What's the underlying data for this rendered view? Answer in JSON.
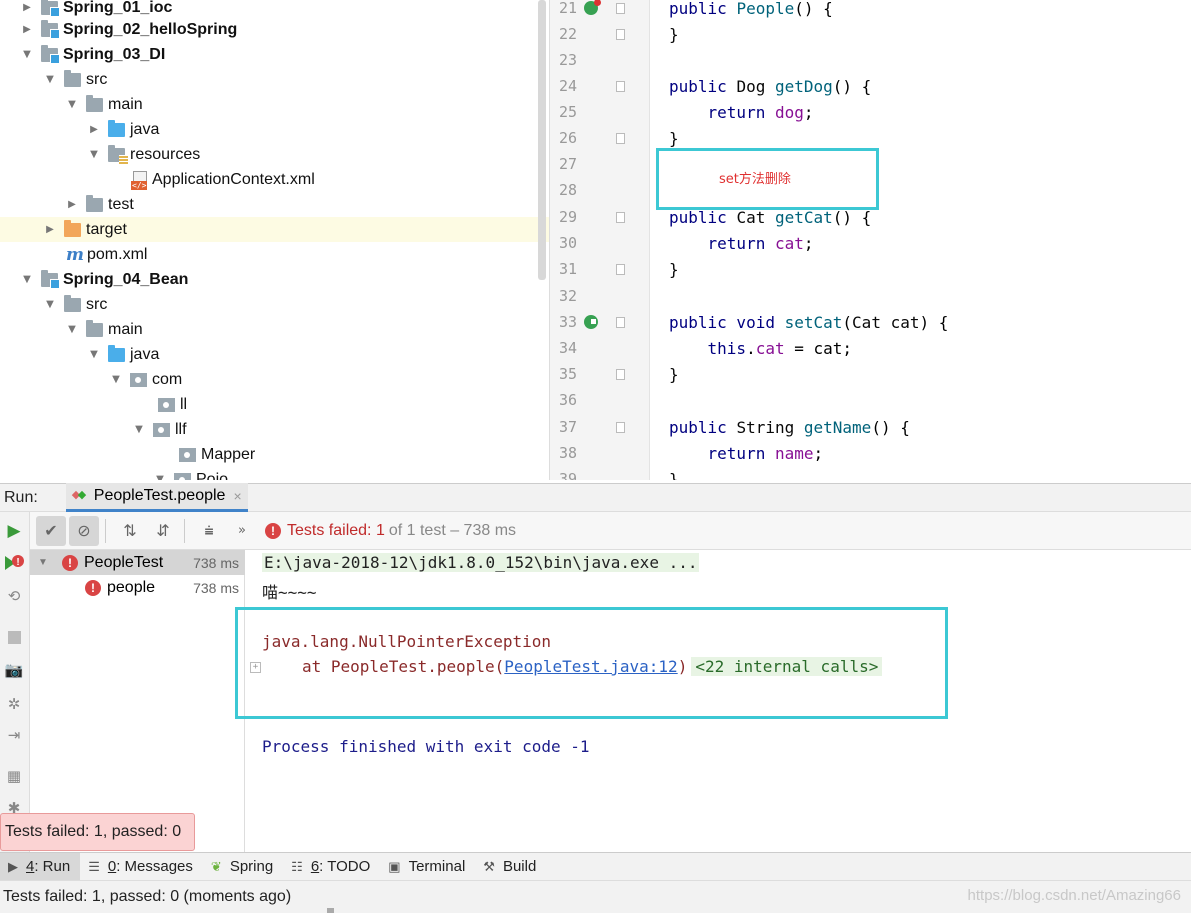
{
  "project_tree": {
    "rows": [
      {
        "label": "Spring_01_ioc",
        "arrow": "▶",
        "icon": "module",
        "bold": true
      },
      {
        "label": "Spring_02_helloSpring",
        "arrow": "▶",
        "icon": "module",
        "bold": true
      },
      {
        "label": "Spring_03_DI",
        "arrow": "▼",
        "icon": "module",
        "bold": true
      },
      {
        "label": "src",
        "arrow": "▼",
        "icon": "folder"
      },
      {
        "label": "main",
        "arrow": "▼",
        "icon": "folder"
      },
      {
        "label": "java",
        "arrow": "▶",
        "icon": "source-folder"
      },
      {
        "label": "resources",
        "arrow": "▼",
        "icon": "resources-folder"
      },
      {
        "label": "ApplicationContext.xml",
        "arrow": "",
        "icon": "xml-file"
      },
      {
        "label": "test",
        "arrow": "▶",
        "icon": "folder"
      },
      {
        "label": "target",
        "arrow": "▶",
        "icon": "excluded-folder",
        "selected": true
      },
      {
        "label": "pom.xml",
        "arrow": "",
        "icon": "maven-file"
      },
      {
        "label": "Spring_04_Bean",
        "arrow": "▼",
        "icon": "module",
        "bold": true
      },
      {
        "label": "src",
        "arrow": "▼",
        "icon": "folder"
      },
      {
        "label": "main",
        "arrow": "▼",
        "icon": "folder"
      },
      {
        "label": "java",
        "arrow": "▼",
        "icon": "source-folder"
      },
      {
        "label": "com",
        "arrow": "▼",
        "icon": "package"
      },
      {
        "label": "ll",
        "arrow": "",
        "icon": "package"
      },
      {
        "label": "llf",
        "arrow": "▼",
        "icon": "package"
      },
      {
        "label": "Mapper",
        "arrow": "",
        "icon": "package"
      },
      {
        "label": "Pojo",
        "arrow": "▼",
        "icon": "package"
      }
    ]
  },
  "editor": {
    "lines": [
      {
        "num": "21",
        "code": "public People() {",
        "gutter": "override-icon"
      },
      {
        "num": "22",
        "code": "}"
      },
      {
        "num": "23",
        "code": ""
      },
      {
        "num": "24",
        "code": "public Dog getDog() {"
      },
      {
        "num": "25",
        "code": "    return dog;"
      },
      {
        "num": "26",
        "code": "}"
      },
      {
        "num": "27",
        "code": ""
      },
      {
        "num": "28",
        "code": ""
      },
      {
        "num": "29",
        "code": "public Cat getCat() {"
      },
      {
        "num": "30",
        "code": "    return cat;"
      },
      {
        "num": "31",
        "code": "}"
      },
      {
        "num": "32",
        "code": ""
      },
      {
        "num": "33",
        "code": "public void setCat(Cat cat) {",
        "gutter": "implement-icon"
      },
      {
        "num": "34",
        "code": "    this.cat = cat;"
      },
      {
        "num": "35",
        "code": "}"
      },
      {
        "num": "36",
        "code": ""
      },
      {
        "num": "37",
        "code": "public String getName() {"
      },
      {
        "num": "38",
        "code": "    return name;"
      },
      {
        "num": "39",
        "code": "}"
      }
    ],
    "annotation": "set方法删除",
    "annotation_color": "#e03030"
  },
  "run_panel": {
    "title": "Run:",
    "tab_label": "PeopleTest.people",
    "tab_close": "×",
    "status_prefix": "Tests failed:",
    "status_failed": "1",
    "status_rest": "of 1 test – 738 ms",
    "test_tree": [
      {
        "name": "PeopleTest",
        "time": "738 ms",
        "selected": true
      },
      {
        "name": "people",
        "time": "738 ms"
      }
    ],
    "console": {
      "command": "E:\\java-2018-12\\jdk1.8.0_152\\bin\\java.exe ...",
      "output": "喵~~~~",
      "exception": "java.lang.NullPointerException",
      "at_prefix": "at PeopleTest.people(",
      "at_link": "PeopleTest.java:12",
      "at_suffix": ")",
      "internal_calls": "<22 internal calls>",
      "exit": "Process finished with exit code -1"
    },
    "tooltip": "Tests failed: 1, passed: 0",
    "error_color": "#d94444"
  },
  "bottom_tabs": [
    {
      "mnemonic": "4",
      "rest": ": Run",
      "icon": "run-icon",
      "active": true
    },
    {
      "mnemonic": "0",
      "rest": ": Messages",
      "icon": "messages-icon"
    },
    {
      "mnemonic": "",
      "rest": "Spring",
      "icon": "spring-icon"
    },
    {
      "mnemonic": "6",
      "rest": ": TODO",
      "icon": "todo-icon"
    },
    {
      "mnemonic": "",
      "rest": "Terminal",
      "icon": "terminal-icon"
    },
    {
      "mnemonic": "",
      "rest": "Build",
      "icon": "build-icon"
    }
  ],
  "status_bar": {
    "text": "Tests failed: 1, passed: 0 (moments ago)",
    "watermark": "https://blog.csdn.net/Amazing66"
  }
}
